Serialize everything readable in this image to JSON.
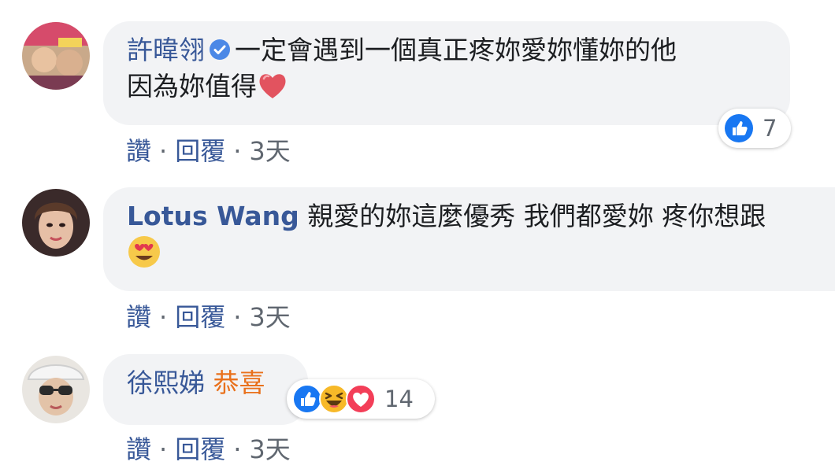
{
  "comments": [
    {
      "author": "許暐翎",
      "verified": true,
      "text_line1": "一定會遇到一個真正疼妳愛妳懂妳的他",
      "text_line2": "因為妳值得",
      "trailing_emoji": "heart-emoji",
      "reaction_count": "7",
      "actions": {
        "like": "讚",
        "reply": "回覆",
        "time": "3天"
      }
    },
    {
      "author": "Lotus Wang",
      "verified": false,
      "text_line1": "親愛的妳這麼優秀 我們都愛妳 疼你想跟",
      "trailing_emoji": "heart-eyes-emoji",
      "actions": {
        "like": "讚",
        "reply": "回覆",
        "time": "3天"
      }
    },
    {
      "author": "徐熙娣",
      "verified": false,
      "text_line1": "恭喜",
      "reaction_icons": [
        "like-icon",
        "haha-icon",
        "love-icon"
      ],
      "reaction_count": "14",
      "actions": {
        "like": "讚",
        "reply": "回覆",
        "time": "3天"
      }
    }
  ],
  "separator": "·",
  "colors": {
    "author": "#385898",
    "bubble": "#f2f3f5",
    "meta": "#606770",
    "like_blue": "#1877f2",
    "love_red": "#f33e58",
    "haha_yellow": "#f7b928",
    "highlight_text": "#e9711c"
  }
}
